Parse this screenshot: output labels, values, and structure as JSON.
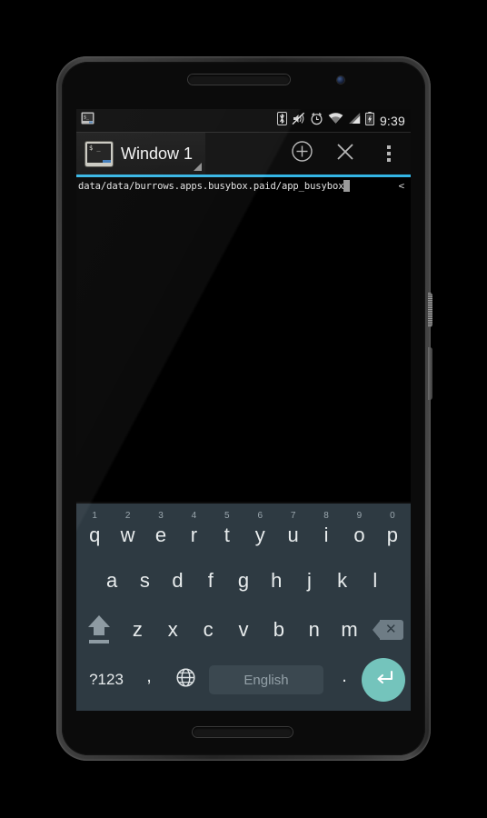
{
  "device": {
    "name": "android-phone",
    "earpiece": "earpiece-speaker",
    "camera": "front-camera"
  },
  "status_bar": {
    "notification_icon": "terminal-notification-icon",
    "icons": [
      "bluetooth-icon",
      "volume-muted-icon",
      "alarm-clock-icon",
      "wifi-icon",
      "cellular-signal-icon",
      "battery-charging-icon"
    ],
    "clock": "9:39"
  },
  "action_bar": {
    "tab": {
      "icon": "terminal-window-icon",
      "label": "Window 1",
      "dropdown_icon": "tab-dropdown-triangle-icon"
    },
    "buttons": [
      {
        "name": "new-window-button",
        "icon": "plus-circle-icon"
      },
      {
        "name": "close-window-button",
        "icon": "close-x-icon"
      },
      {
        "name": "overflow-menu-button",
        "icon": "overflow-dots-icon"
      }
    ],
    "accent_color": "#33b5e5"
  },
  "terminal": {
    "line": "data/data/burrows.apps.busybox.paid/app_busybox",
    "cursor": "block-cursor",
    "right_marker": "<",
    "background": "#000000",
    "text_color": "#e2e2e2"
  },
  "keyboard": {
    "background": "#2e3a42",
    "enter_color": "#74c4bc",
    "row_top": [
      {
        "letter": "q",
        "num": "1"
      },
      {
        "letter": "w",
        "num": "2"
      },
      {
        "letter": "e",
        "num": "3"
      },
      {
        "letter": "r",
        "num": "4"
      },
      {
        "letter": "t",
        "num": "5"
      },
      {
        "letter": "y",
        "num": "6"
      },
      {
        "letter": "u",
        "num": "7"
      },
      {
        "letter": "i",
        "num": "8"
      },
      {
        "letter": "o",
        "num": "9"
      },
      {
        "letter": "p",
        "num": "0"
      }
    ],
    "row_home": [
      {
        "letter": "a"
      },
      {
        "letter": "s"
      },
      {
        "letter": "d"
      },
      {
        "letter": "f"
      },
      {
        "letter": "g"
      },
      {
        "letter": "h"
      },
      {
        "letter": "j"
      },
      {
        "letter": "k"
      },
      {
        "letter": "l"
      }
    ],
    "row_shift": [
      {
        "letter": "z"
      },
      {
        "letter": "x"
      },
      {
        "letter": "c"
      },
      {
        "letter": "v"
      },
      {
        "letter": "b"
      },
      {
        "letter": "n"
      },
      {
        "letter": "m"
      }
    ],
    "shift_key": "shift-key",
    "backspace_key": "backspace-key",
    "row_bottom": {
      "symbols": "?123",
      "comma": ",",
      "globe": "language-globe-icon",
      "space": "English",
      "period": ".",
      "enter": "enter-return-icon"
    }
  }
}
